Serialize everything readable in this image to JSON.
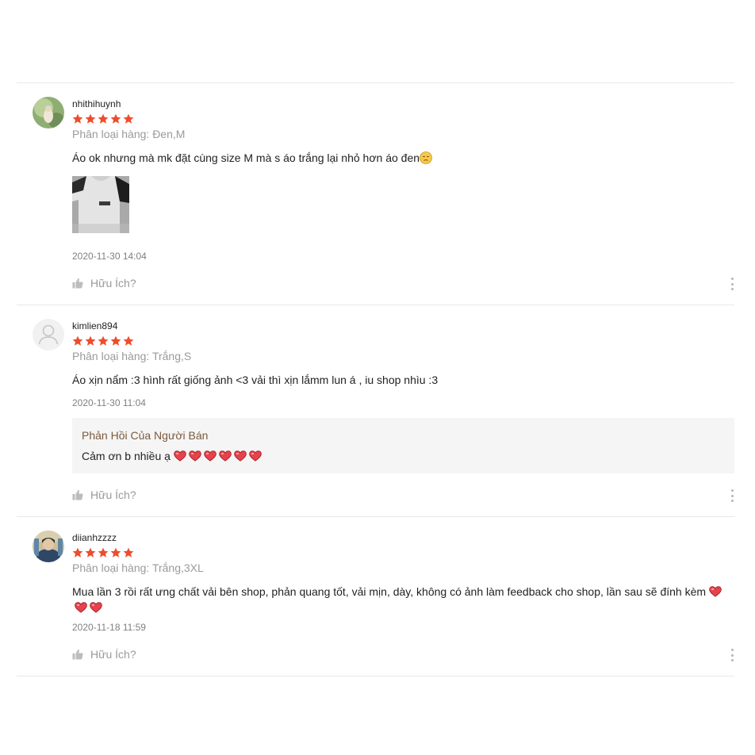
{
  "colors": {
    "star": "#ee4d2d",
    "heart": "#e6424a",
    "reply_title": "#7b5a3c",
    "muted": "#9a9a9a"
  },
  "reviews": [
    {
      "username": "nhithihuynh",
      "rating": 5,
      "variant": "Phân loại hàng: Đen,M",
      "comment": "Áo ok nhưng mà mk đặt cùng size M mà s áo trắng lại nhỏ hơn áo đen",
      "comment_emoji": "pensive-face-icon",
      "date": "2020-11-30 14:04",
      "helpful": "Hữu Ích?"
    },
    {
      "username": "kimlien894",
      "rating": 5,
      "variant": "Phân loại hàng: Trắng,S",
      "comment": "Áo xịn nẩm :3 hình rất giống ảnh <3 vải thì xịn lắmm lun á , iu shop nhìu :3",
      "date": "2020-11-30 11:04",
      "reply_title": "Phản Hồi Của Người Bán",
      "reply_text": "Cảm ơn b nhiều ạ",
      "reply_hearts": 6,
      "helpful": "Hữu Ích?"
    },
    {
      "username": "diianhzzzz",
      "rating": 5,
      "variant": "Phân loại hàng: Trắng,3XL",
      "comment": "Mua lần 3 rồi rất ưng chất vải bên shop, phản quang tốt, vải mịn, dày, không có ảnh làm feedback cho shop, lần sau sẽ đính kèm",
      "comment_hearts": 3,
      "date": "2020-11-18 11:59",
      "helpful": "Hữu Ích?"
    }
  ]
}
